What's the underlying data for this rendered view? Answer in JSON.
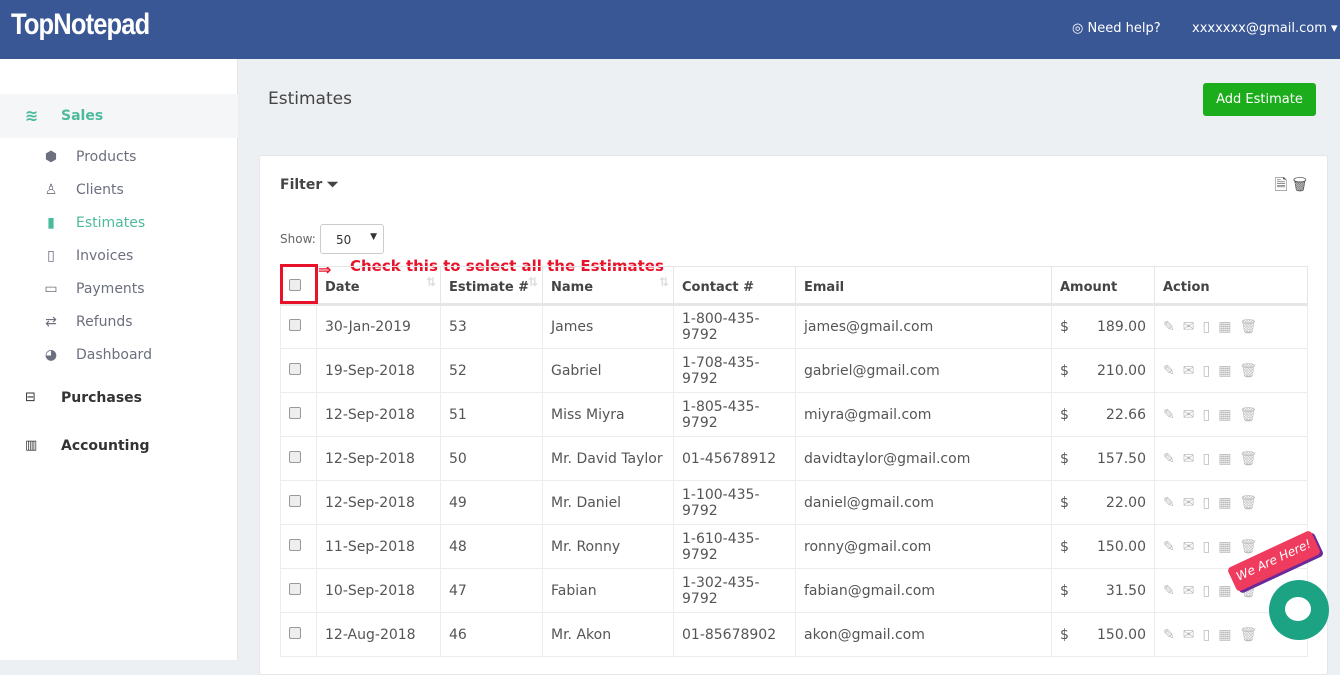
{
  "header": {
    "logo": "TopNotepad",
    "help": "Need help?",
    "user": "xxxxxxx@gmail.com"
  },
  "sidebar": {
    "sales": "Sales",
    "items": [
      {
        "label": "Products",
        "icon": "cubes-icon"
      },
      {
        "label": "Clients",
        "icon": "user-icon"
      },
      {
        "label": "Estimates",
        "icon": "file-icon",
        "active": true
      },
      {
        "label": "Invoices",
        "icon": "file-o-icon"
      },
      {
        "label": "Payments",
        "icon": "credit-card-icon"
      },
      {
        "label": "Refunds",
        "icon": "exchange-icon"
      },
      {
        "label": "Dashboard",
        "icon": "dashboard-icon"
      }
    ],
    "purchases": "Purchases",
    "accounting": "Accounting"
  },
  "page": {
    "title": "Estimates",
    "add": "Add Estimate",
    "filter": "Filter",
    "show_label": "Show:",
    "show_value": "50",
    "note": "Check this to select all the Estimates"
  },
  "table": {
    "headers": [
      "Date",
      "Estimate #",
      "Name",
      "Contact #",
      "Email",
      "Amount",
      "Action"
    ],
    "rows": [
      [
        "30-Jan-2019",
        "53",
        "James",
        "1-800-435-9792",
        "james@gmail.com",
        "$",
        "189.00"
      ],
      [
        "19-Sep-2018",
        "52",
        "Gabriel",
        "1-708-435-9792",
        "gabriel@gmail.com",
        "$",
        "210.00"
      ],
      [
        "12-Sep-2018",
        "51",
        "Miss Miyra",
        "1-805-435-9792",
        "miyra@gmail.com",
        "$",
        "22.66"
      ],
      [
        "12-Sep-2018",
        "50",
        "Mr. David Taylor",
        "01-45678912",
        "davidtaylor@gmail.com",
        "$",
        "157.50"
      ],
      [
        "12-Sep-2018",
        "49",
        "Mr. Daniel",
        "1-100-435-9792",
        "daniel@gmail.com",
        "$",
        "22.00"
      ],
      [
        "11-Sep-2018",
        "48",
        "Mr. Ronny",
        "1-610-435-9792",
        "ronny@gmail.com",
        "$",
        "150.00"
      ],
      [
        "10-Sep-2018",
        "47",
        "Fabian",
        "1-302-435-9792",
        "fabian@gmail.com",
        "$",
        "31.50"
      ],
      [
        "12-Aug-2018",
        "46",
        "Mr. Akon",
        "01-85678902",
        "akon@gmail.com",
        "$",
        "150.00"
      ]
    ]
  },
  "chat": {
    "badge": "We Are Here!"
  },
  "colors": {
    "header": "#3a5795",
    "accent": "#4dba9c",
    "add": "#1bad1b",
    "annotation": "#e8132a"
  }
}
